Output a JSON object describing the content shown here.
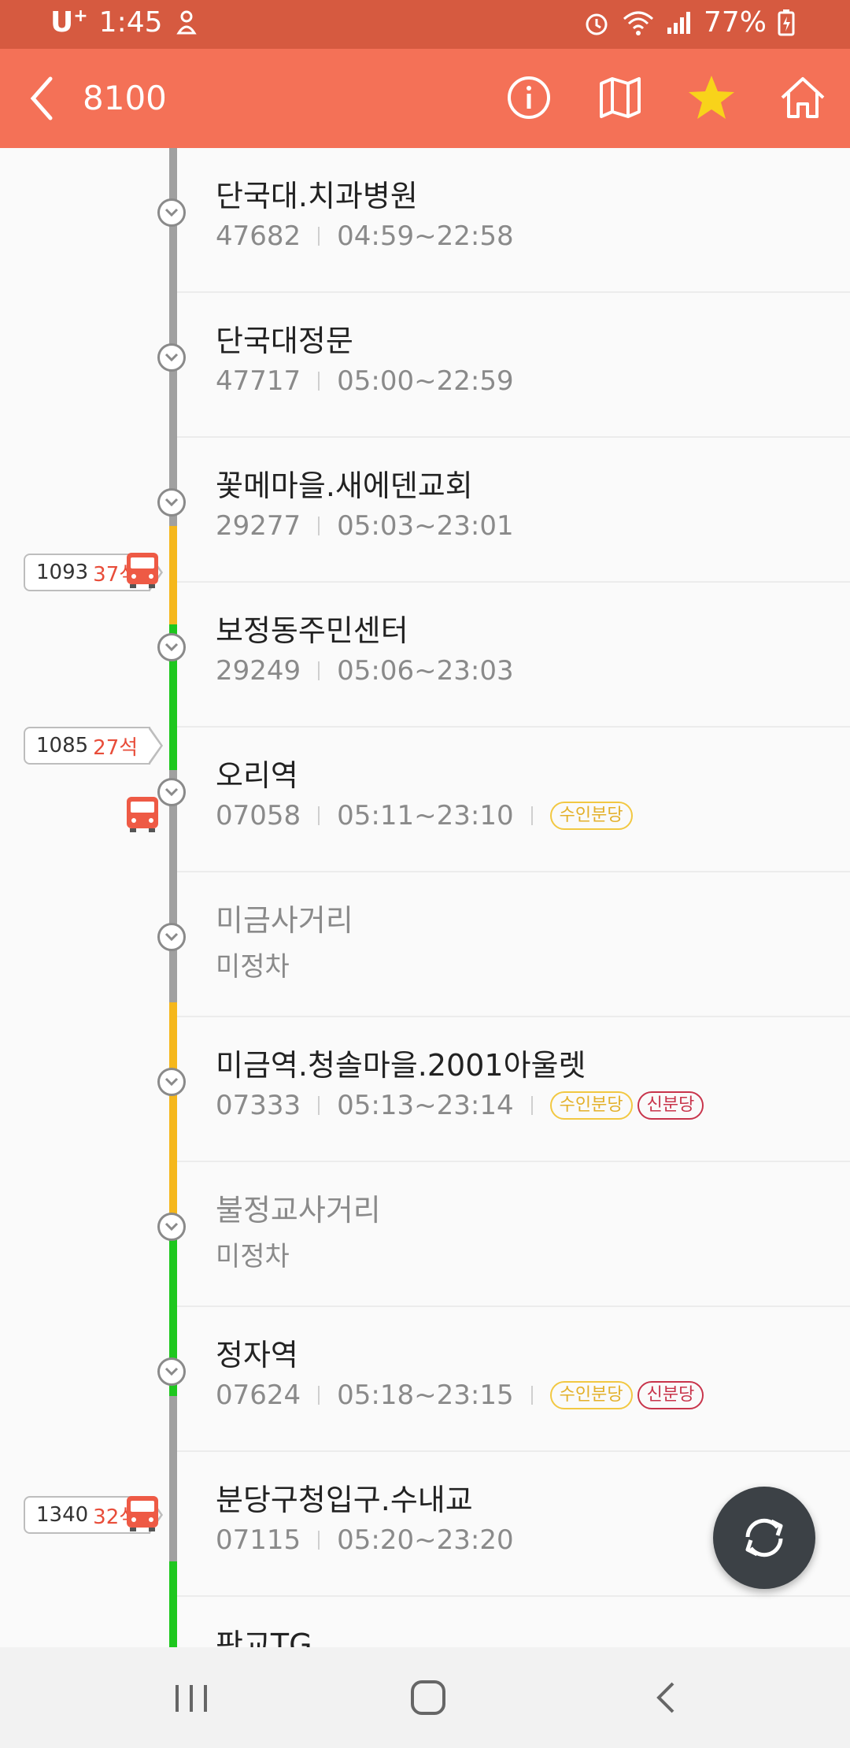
{
  "status_bar": {
    "carrier": "U",
    "carrier_sup": "+",
    "time": "1:45",
    "battery": "77%"
  },
  "app_bar": {
    "title": "8100",
    "icons": [
      "info-icon",
      "map-icon",
      "star-icon",
      "home-icon"
    ],
    "accent": "#f47157",
    "star_color": "#f8d31a"
  },
  "stops": [
    {
      "name": "단국대.치과병원",
      "id": "47682",
      "hours": "04:59~22:58",
      "tags": [],
      "active": true
    },
    {
      "name": "단국대정문",
      "id": "47717",
      "hours": "05:00~22:59",
      "tags": [],
      "active": true
    },
    {
      "name": "꽃메마을.새에덴교회",
      "id": "29277",
      "hours": "05:03~23:01",
      "tags": [],
      "active": true
    },
    {
      "name": "보정동주민센터",
      "id": "29249",
      "hours": "05:06~23:03",
      "tags": [],
      "active": true
    },
    {
      "name": "오리역",
      "id": "07058",
      "hours": "05:11~23:10",
      "tags": [
        "수인분당"
      ],
      "active": true
    },
    {
      "name": "미금사거리",
      "id": "",
      "hours": "",
      "status": "미정차",
      "tags": [],
      "active": false
    },
    {
      "name": "미금역.청솔마을.2001아울렛",
      "id": "07333",
      "hours": "05:13~23:14",
      "tags": [
        "수인분당",
        "신분당"
      ],
      "active": true
    },
    {
      "name": "불정교사거리",
      "id": "",
      "hours": "",
      "status": "미정차",
      "tags": [],
      "active": false
    },
    {
      "name": "정자역",
      "id": "07624",
      "hours": "05:18~23:15",
      "tags": [
        "수인분당",
        "신분당"
      ],
      "active": true
    },
    {
      "name": "분당구청입구.수내교",
      "id": "07115",
      "hours": "05:20~23:20",
      "tags": [],
      "active": true
    },
    {
      "name": "판교TG",
      "id": "",
      "hours": "",
      "tags": [],
      "active": true
    }
  ],
  "buses": [
    {
      "plate": "1093",
      "seats": "37석"
    },
    {
      "plate": "1085",
      "seats": "27석"
    },
    {
      "plate": "1340",
      "seats": "32석"
    }
  ],
  "colors": {
    "gray_line": "#a0a0a0",
    "yellow_line": "#f5b71c",
    "green_line": "#1ec71e",
    "bus_red": "#ee5a45"
  }
}
